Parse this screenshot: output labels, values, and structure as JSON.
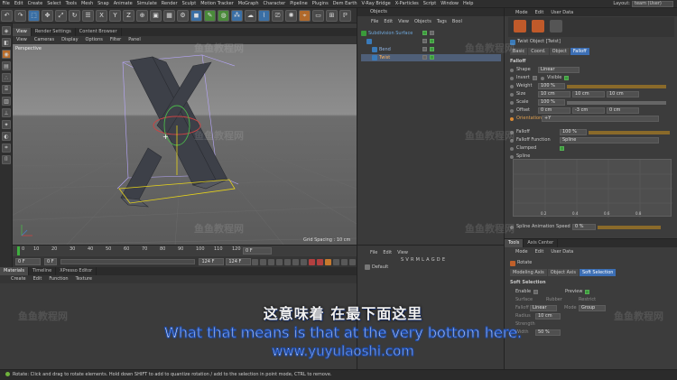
{
  "menubar": {
    "items": [
      "File",
      "Edit",
      "Create",
      "Select",
      "Tools",
      "Mesh",
      "Snap",
      "Animate",
      "Simulate",
      "Render",
      "Sculpt",
      "Motion Tracker",
      "MoGraph",
      "Character",
      "Pipeline",
      "Plugins",
      "Dem Earth",
      "V-Ray Bridge",
      "X-Particles",
      "Script",
      "Window",
      "Help"
    ],
    "layout_label": "Layout:",
    "layout_value": "team (User)"
  },
  "viewport": {
    "tabs": [
      "View",
      "Render Settings",
      "Content Browser"
    ],
    "menu": [
      "View",
      "Cameras",
      "Display",
      "Options",
      "Filter",
      "Panel"
    ],
    "camera_label": "Perspective",
    "grid_spacing": "Grid Spacing : 10 cm"
  },
  "timeline": {
    "ticks": [
      "0",
      "10",
      "20",
      "30",
      "40",
      "50",
      "60",
      "70",
      "80",
      "90",
      "100",
      "110",
      "120"
    ],
    "current_frame": "0 F",
    "start": "0 F",
    "end": "124 F",
    "max": "124 F",
    "frame_field": "0 F"
  },
  "materials": {
    "tabs": [
      "Materials",
      "Timeline",
      "XPresso Editor"
    ],
    "menu": [
      "Create",
      "Edit",
      "Function",
      "Texture"
    ]
  },
  "objects": {
    "title": "Objects",
    "menu": [
      "File",
      "Edit",
      "View",
      "Objects",
      "Tags",
      "Bool"
    ],
    "items": [
      {
        "name": "Subdivision Surface",
        "color": "#6fa8dc"
      },
      {
        "name": "Bend",
        "color": "#4a7fc7"
      },
      {
        "name": "Twist",
        "color": "#4a7fc7"
      }
    ]
  },
  "layers": {
    "menu": [
      "File",
      "Edit",
      "View"
    ],
    "columns": "S V R M L A G D E",
    "row": "Default"
  },
  "attributes": {
    "menu": [
      "Mode",
      "Edit",
      "User Data"
    ],
    "object_title": "Twist Object [Twist]",
    "tabs": [
      "Basic",
      "Coord.",
      "Object",
      "Falloff"
    ],
    "section": "Falloff",
    "shape_label": "Shape",
    "shape_value": "Linear",
    "invert_label": "Invert",
    "visible_label": "Visible",
    "weight_label": "Weight",
    "weight_value": "100 %",
    "size_label": "Size",
    "size_values": [
      "10 cm",
      "10 cm",
      "10 cm"
    ],
    "scale_label": "Scale",
    "scale_value": "100 %",
    "offset_label": "Offset",
    "offset_values": [
      "0 cm",
      "-3 cm",
      "0 cm"
    ],
    "orientation_label": "Orientation",
    "orientation_value": "+Y",
    "falloff_label": "Falloff",
    "falloff_value": "100 %",
    "falloff_function_label": "Falloff Function",
    "falloff_function_value": "Spline",
    "clamped_label": "Clamped",
    "spline_label": "Spline",
    "graph_labels": [
      "0.2",
      "0.4",
      "0.6",
      "0.8"
    ],
    "anim_speed_label": "Spline Animation Speed",
    "anim_speed_value": "0 %"
  },
  "attributes2": {
    "tabs": [
      "Tools",
      "Axis Center"
    ],
    "menu": [
      "Mode",
      "Edit",
      "User Data"
    ],
    "tool_title": "Rotate",
    "subtabs": [
      "Modeling Axis",
      "Object Axis",
      "Soft Selection"
    ],
    "section": "Soft Selection",
    "enable_label": "Enable",
    "preview_label": "Preview",
    "surface_label": "Surface",
    "rubber_label": "Rubber",
    "restrict_label": "Restrict",
    "falloff_label": "Falloff",
    "falloff_value": "Linear",
    "mode_label": "Mode",
    "mode_value": "Group",
    "radius_label": "Radius",
    "radius_value": "10 cm",
    "strength_label": "Strength",
    "width_label": "Width",
    "width_value": "50 %"
  },
  "status": {
    "text": "Rotate: Click and drag to rotate elements. Hold down SHIFT to add to quantize rotation / add to the selection in point mode, CTRL to remove."
  },
  "subtitles": {
    "zh": "这意味着 在最下面这里",
    "en": "What that means is that at the very bottom here.",
    "url": "www.yuyulaoshi.com"
  },
  "watermark": "鱼鱼教程网",
  "colors": {
    "accent": "#3c6fb5",
    "active_orange": "#d98a34",
    "record_red": "#b34040"
  }
}
